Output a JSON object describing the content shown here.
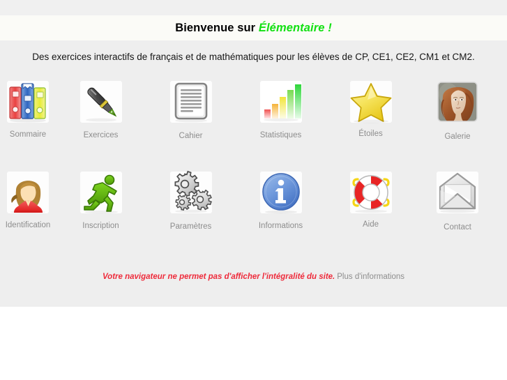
{
  "header": {
    "title_prefix": "Bienvenue sur ",
    "title_accent": "Élémentaire !",
    "subtitle": "Des exercices interactifs de français et de mathématiques pour les élèves de CP, CE1, CE2, CM1 et CM2."
  },
  "colors": {
    "page_background": "#ffffff",
    "panel_background": "#eeeeee",
    "title_band_background": "#fbfbf7",
    "accent_green": "#12e012",
    "caption_gray": "#8d8d8d",
    "warning_red": "#ee2b3b"
  },
  "grid": {
    "rows": [
      [
        {
          "label": "Sommaire",
          "icon": "binders-icon"
        },
        {
          "label": "Exercices",
          "icon": "fountain-pen-icon"
        },
        {
          "label": "Cahier",
          "icon": "document-icon"
        },
        {
          "label": "Statistiques",
          "icon": "bar-chart-icon"
        },
        {
          "label": "Étoiles",
          "icon": "star-icon"
        },
        {
          "label": "Galerie",
          "icon": "portrait-painting-icon"
        }
      ],
      [
        {
          "label": "Identification",
          "icon": "user-avatar-icon"
        },
        {
          "label": "Inscription",
          "icon": "running-person-icon"
        },
        {
          "label": "Paramètres",
          "icon": "gears-icon"
        },
        {
          "label": "Informations",
          "icon": "info-circle-icon"
        },
        {
          "label": "Aide",
          "icon": "lifebuoy-icon"
        },
        {
          "label": "Contact",
          "icon": "envelope-icon"
        }
      ]
    ]
  },
  "footer": {
    "warning_text": "Votre navigateur ne permet pas d'afficher l'intégralité du site.",
    "warning_link": "Plus d'informations"
  }
}
